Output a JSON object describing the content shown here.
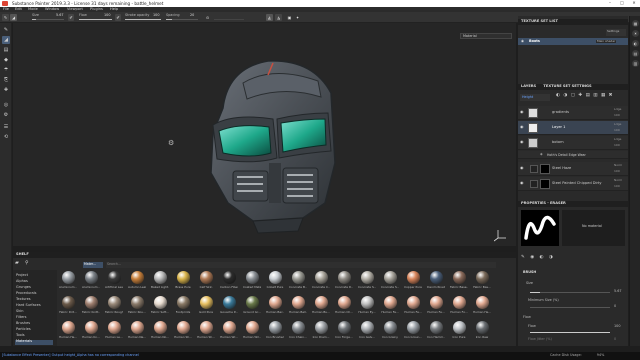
{
  "window": {
    "title": "Substance Painter 2019.3.3 - License 31 days remaining - battle_helmet"
  },
  "menu": [
    "File",
    "Edit",
    "Mode",
    "Window",
    "Viewport",
    "Plugins",
    "Help"
  ],
  "toolbar": {
    "size_label": "Size",
    "size_value": "5.67",
    "flow_label": "Flow",
    "flow_value": "100",
    "stroke_label": "Stroke opacity",
    "stroke_value": "100",
    "spacing_label": "Spacing",
    "spacing_value": "20",
    "size_fill": 0.12,
    "flow_fill": 1.0,
    "stroke_fill": 1.0,
    "spacing_fill": 0.2
  },
  "viewport": {
    "mode": "Material"
  },
  "texture_set_list": {
    "title": "TEXTURE SET LIST",
    "settings": "Settings",
    "item": "Boots",
    "shader": "Main shader"
  },
  "layers_panel": {
    "tab1": "LAYERS",
    "tab2": "TEXTURE SET SETTINGS",
    "channel": "Height",
    "layers": [
      {
        "name": "gradients",
        "blend": "Ldge",
        "opacity": "100"
      },
      {
        "name": "Layer 1",
        "blend": "Ldge",
        "opacity": "100"
      },
      {
        "name": "botom",
        "blend": "Ldge",
        "opacity": "100"
      },
      {
        "name": "Hoth's Detail Edge Wear",
        "blend": "",
        "opacity": ""
      },
      {
        "name": "Steel Haze",
        "blend": "Norm",
        "opacity": "100"
      },
      {
        "name": "Steel Painted Chipped Dirty",
        "blend": "Norm",
        "opacity": "100"
      }
    ]
  },
  "properties": {
    "title": "PROPERTIES - ERASER",
    "material_label": "No material",
    "section": "BRUSH",
    "size_label": "Size",
    "size_value": "5.67",
    "minsize_label": "Minimum Size (%)",
    "minsize_value": "0",
    "flow_section": "Flow",
    "flow_label": "Flow",
    "flow_value": "100",
    "flowjitter_label": "Flow Jitter (%)",
    "flowjitter_value": "0"
  },
  "shelf": {
    "title": "SHELF",
    "filter": "Mater...",
    "search_placeholder": "Search...",
    "categories": [
      "Project",
      "Alphas",
      "Grunges",
      "Procedurals",
      "Textures",
      "Hard Surfaces",
      "Skin",
      "Filters",
      "Brushes",
      "Particles",
      "Tools",
      "Materials"
    ],
    "selected_category": "Materials",
    "materials_row1": [
      "Aluminium ...",
      "Aluminium ...",
      "Artificial Lea...",
      "Autumn Leaf",
      "Baked Light...",
      "Brass Pure",
      "Calf Skin",
      "Carbon Fiber",
      "Coated Metal",
      "Cobalt Pure",
      "Concrete B...",
      "Concrete C...",
      "Concrete D...",
      "Concrete S...",
      "Concrete S...",
      "Copper Pure",
      "Denim Rivet",
      "Fabric Base...",
      "Fabric Bas..."
    ],
    "materials_row2": [
      "Fabric Dirt...",
      "Fabric Knitt...",
      "Fabric Rough",
      "Fabric Rou...",
      "Fabric Soft...",
      "Footprints",
      "Gold Pure",
      "Gouache P...",
      "Ground Gr...",
      "Human Bac...",
      "Human Bell...",
      "Human Bu...",
      "Human Ch...",
      "Human Ey...",
      "Human Fa...",
      "Human Fe...",
      "Human Fe...",
      "Human Fo...",
      "Human He..."
    ],
    "materials_row3": [
      "Human He...",
      "Human Kn...",
      "Human Le...",
      "Human Ne...",
      "Human No...",
      "Human Sh...",
      "Human Sh...",
      "Human Wr...",
      "Human Wri...",
      "Iron Brushed",
      "Iron Chain...",
      "Iron Diam...",
      "Iron Forge...",
      "Iron Galv...",
      "Iron Grainy",
      "Iron Groun...",
      "Iron Hamm...",
      "Iron Pure",
      "Iron Raw"
    ]
  },
  "status": {
    "message": "[Substance Effect Presenter] Output height_Alpha has no corresponding channel",
    "cache": "Cache Disk Usage:",
    "cache_value": "94%"
  },
  "colors": {
    "accent": "#3d4f66",
    "visor": "#1ea88a",
    "helmet": "#4a4f55"
  }
}
